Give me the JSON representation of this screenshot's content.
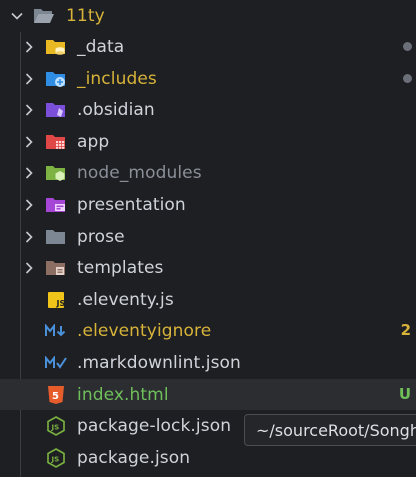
{
  "root": {
    "label": "11ty",
    "icon": "folder-open-icon"
  },
  "items": [
    {
      "label": "_data",
      "icon": "folder-data-icon",
      "color": "#e8b923",
      "dot": true
    },
    {
      "label": "_includes",
      "icon": "folder-includes-icon",
      "color": "#2f8de4",
      "dot": true
    },
    {
      "label": ".obsidian",
      "icon": "folder-obsidian-icon",
      "color": "#7b4fd9"
    },
    {
      "label": "app",
      "icon": "folder-app-icon",
      "color": "#e04848"
    },
    {
      "label": "node_modules",
      "icon": "folder-node-icon",
      "color": "#7cb342"
    },
    {
      "label": "presentation",
      "icon": "folder-presentation-icon",
      "color": "#a646d6"
    },
    {
      "label": "prose",
      "icon": "folder-icon",
      "color": "#7d8794"
    },
    {
      "label": "templates",
      "icon": "folder-templates-icon",
      "color": "#8d6e63"
    },
    {
      "label": ".eleventy.js",
      "icon": "js-file-icon"
    },
    {
      "label": ".eleventyignore",
      "icon": "markdown-ignore-icon",
      "badge": "2"
    },
    {
      "label": ".markdownlint.json",
      "icon": "markdownlint-icon"
    },
    {
      "label": "index.html",
      "icon": "html-file-icon",
      "badge": "U"
    },
    {
      "label": "package-lock.json",
      "icon": "nodejs-icon"
    },
    {
      "label": "package.json",
      "icon": "nodejs-icon"
    }
  ],
  "tooltip": {
    "text": "~/sourceRoot/Songh"
  },
  "colors": {
    "yellow": "#d7b33a",
    "green": "#6fbf5a",
    "dim": "#8a8f98"
  }
}
